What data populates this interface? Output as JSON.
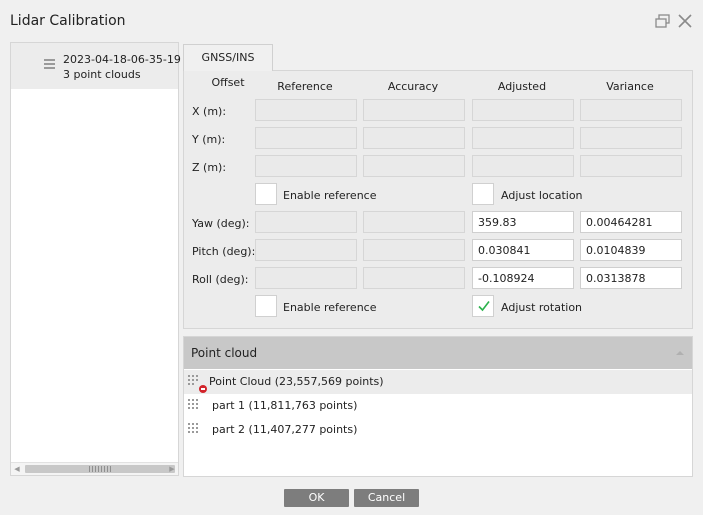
{
  "window": {
    "title": "Lidar Calibration",
    "restore_icon": "restore-icon",
    "close_icon": "close-icon"
  },
  "dataset_list": {
    "items": [
      {
        "name": "2023-04-18-06-35-19",
        "subtitle": "3 point clouds",
        "icon": "drag-handle-icon"
      }
    ]
  },
  "tabs": [
    {
      "label": "GNSS/INS Offset",
      "active": true
    }
  ],
  "offset_table": {
    "columns": [
      "Reference",
      "Accuracy",
      "Adjusted",
      "Variance"
    ],
    "location_rows": [
      {
        "label": "X (m):",
        "reference": "",
        "accuracy": "",
        "adjusted": "",
        "variance": ""
      },
      {
        "label": "Y (m):",
        "reference": "",
        "accuracy": "",
        "adjusted": "",
        "variance": ""
      },
      {
        "label": "Z (m):",
        "reference": "",
        "accuracy": "",
        "adjusted": "",
        "variance": ""
      }
    ],
    "location_enable_reference": {
      "label": "Enable reference",
      "checked": false
    },
    "adjust_location": {
      "label": "Adjust location",
      "checked": false
    },
    "rotation_rows": [
      {
        "label": "Yaw (deg):",
        "reference": "",
        "accuracy": "",
        "adjusted": "359.83",
        "variance": "0.00464281"
      },
      {
        "label": "Pitch (deg):",
        "reference": "",
        "accuracy": "",
        "adjusted": "0.030841",
        "variance": "0.0104839"
      },
      {
        "label": "Roll (deg):",
        "reference": "",
        "accuracy": "",
        "adjusted": "-0.108924",
        "variance": "0.0313878"
      }
    ],
    "rotation_enable_reference": {
      "label": "Enable reference",
      "checked": false
    },
    "adjust_rotation": {
      "label": "Adjust rotation",
      "checked": true
    }
  },
  "point_cloud_panel": {
    "header": "Point cloud",
    "rows": [
      {
        "label": "Point Cloud (23,557,569 points)",
        "selected": true,
        "icon": "point-cloud-removed-icon"
      },
      {
        "label": "part 1 (11,811,763 points)",
        "selected": false,
        "icon": "point-cloud-icon"
      },
      {
        "label": "part 2 (11,407,277 points)",
        "selected": false,
        "icon": "point-cloud-icon"
      }
    ]
  },
  "footer": {
    "ok_label": "OK",
    "cancel_label": "Cancel"
  },
  "colors": {
    "check_mark": "#2bb24c",
    "remove_badge": "#d2232a",
    "button_bg": "#7d7d7d",
    "header_bg": "#c8c8c8"
  }
}
